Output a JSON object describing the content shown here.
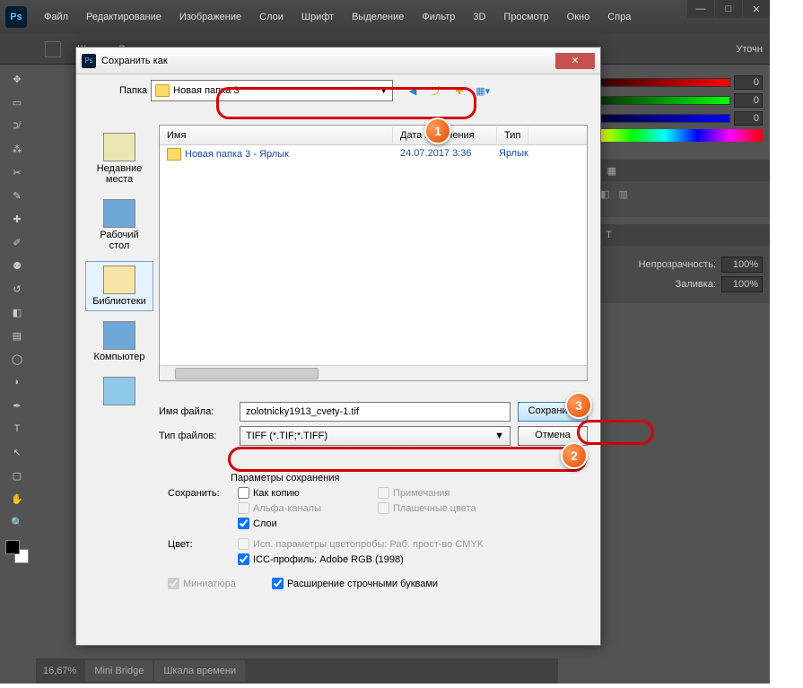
{
  "ps": {
    "logo": "Ps",
    "menu": [
      "Файл",
      "Редактирование",
      "Изображение",
      "Слои",
      "Шрифт",
      "Выделение",
      "Фильтр",
      "3D",
      "Просмотр",
      "Окно",
      "Спра"
    ],
    "opts": {
      "width_label": "Шир.:",
      "height_label": "Выс.:",
      "refine": "Уточн"
    },
    "bottom": {
      "zoom": "16,67%",
      "tabs": [
        "Mini Bridge",
        "Шкала времени"
      ]
    },
    "panels": {
      "rgb": {
        "r": "0",
        "g": "0",
        "b": "0"
      },
      "opacity_label": "Непрозрачность:",
      "opacity": "100%",
      "fill_label": "Заливка:",
      "fill": "100%"
    }
  },
  "dlg": {
    "title": "Сохранить как",
    "folder_label": "Папка",
    "folder": "Новая папка 3",
    "cols": {
      "name": "Имя",
      "date": "Дата изменения",
      "type": "Тип"
    },
    "row": {
      "name": "Новая папка 3 - Ярлык",
      "date": "24.07.2017 3:36",
      "type": "Ярлык"
    },
    "places": {
      "recent": "Недавние места",
      "desktop": "Рабочий стол",
      "lib": "Библиотеки",
      "computer": "Компьютер"
    },
    "filename_label": "Имя файла:",
    "filename": "zolotnicky1913_cvety-1.tif",
    "filetype_label": "Тип файлов:",
    "filetype": "TIFF (*.TIF;*.TIFF)",
    "save_btn": "Сохранить",
    "cancel_btn": "Отмена",
    "opts_title": "Параметры сохранения",
    "save_label": "Сохранить:",
    "as_copy": "Как копию",
    "notes": "Примечания",
    "alpha": "Альфа-каналы",
    "spot": "Плашечные цвета",
    "layers": "Слои",
    "color_label": "Цвет:",
    "proof": "Исп. параметры цветопробы:  Раб. прост-во CMYK",
    "icc": "ICC-профиль:  Adobe RGB (1998)",
    "thumb": "Миниатюра",
    "lc_ext": "Расширение строчными буквами"
  },
  "badges": {
    "1": "1",
    "2": "2",
    "3": "3"
  }
}
